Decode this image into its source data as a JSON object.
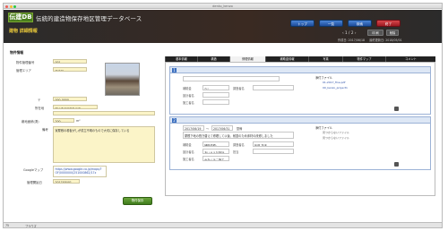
{
  "window": {
    "title": "dento_kenzo"
  },
  "header": {
    "logo": "伝建DB",
    "db_title": "伝統的建造物保存地区管理データベース",
    "subtitle": "建物 詳細情報",
    "page": "1",
    "page_total": "2",
    "prev_label": "前",
    "next_label": "次",
    "print_label": "印 刷",
    "save_label": "削除",
    "created": "作成日: 2017/06/18",
    "updated": "最終更新日: 2018/05/01"
  },
  "nav": {
    "top": "トップ",
    "list": "一覧",
    "search": "検索",
    "close": "終了"
  },
  "left": {
    "section": "物件情報",
    "fields": [
      {
        "label": "物件管理番号",
        "value": "001"
      },
      {
        "label": "管理エリア",
        "value": "西地区"
      },
      {
        "label": "〒",
        "value": "000-0000"
      },
      {
        "label": "所在地",
        "value": "岡山市北区本丸三丁"
      },
      {
        "label": "敷地面積(測)",
        "value": "200"
      },
      {
        "label": "備考",
        "value": "家屋敷の看板がしが成立不明のもので大切に保存している"
      },
      {
        "label": "Googleマップ",
        "value": "https://www.google.co.jp/maps/?OF/0000000/251000862/17z"
      },
      {
        "label": "管理開始日",
        "value": "2017/05/01"
      }
    ],
    "area_unit": "m²",
    "save_button": "物件保存"
  },
  "tabs": [
    "基本情報",
    "構造",
    "修理情報",
    "補助金情報",
    "写真",
    "物件マップ",
    "コメント"
  ],
  "repair1": {
    "id": "1",
    "fields": {
      "補助金": "なし",
      "調査者名": "",
      "設計者名": "",
      "施工者名": ""
    },
    "attach_title": "添付ファイル",
    "files": [
      "01-2017_fine.pdf",
      "00_kenzo_project1"
    ]
  },
  "repair2": {
    "id": "2",
    "date_from": "2017/06/19",
    "date_to": "2017/06/31",
    "status_label": "整備",
    "status": "",
    "summary": "屋根下地の葺き替えて修理して以後、耐震のため床材の改修しました",
    "subsidy": "補助金",
    "subsidy_amount": "補助金額: 3,000,000円",
    "inspector": "矢部 花子",
    "designer": "あいうえお設計",
    "constructor": "かきくけこ施工",
    "staff_label": "担当",
    "staff": "",
    "attach_title": "添付ファイル",
    "files": [
      "見つからないファイル",
      "見つからないファイル"
    ]
  },
  "labels": {
    "subsidy": "補助金",
    "inspector": "調査者名",
    "designer": "設計者名",
    "constructor": "施工者名"
  },
  "bottom": {
    "zoom": "75",
    "mode": "ブラウズ"
  },
  "colors": {
    "accent_green": "#4a7e1d",
    "nav_blue": "#1d4c9a",
    "nav_red": "#9d1a22",
    "field_yellow": "#fbf4c8",
    "header_bg": "#2b2b2b"
  }
}
